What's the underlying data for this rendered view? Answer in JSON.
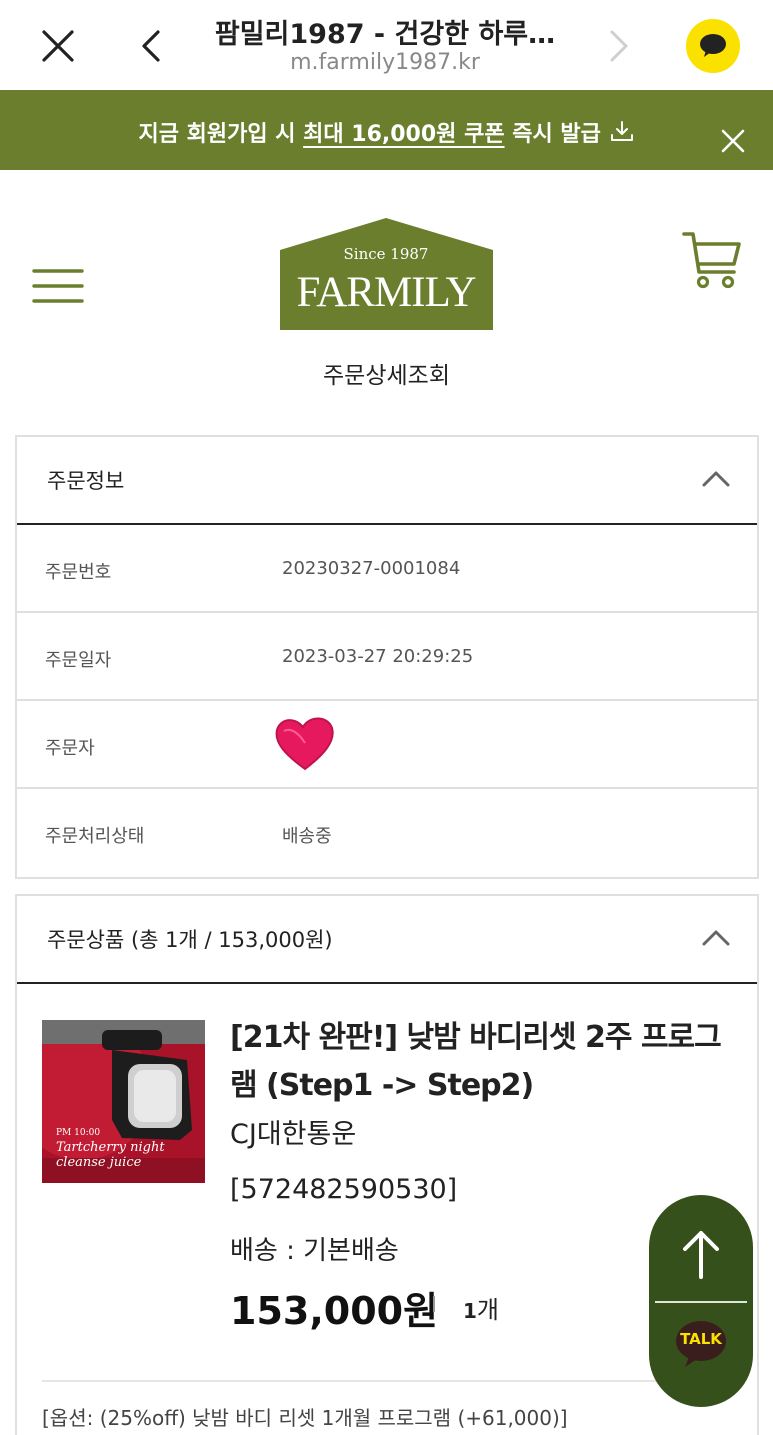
{
  "browser": {
    "title": "팜밀리1987 - 건강한 하루…",
    "url": "m.farmily1987.kr",
    "close_icon": "close-icon",
    "back_icon": "chevron-left-icon",
    "forward_icon": "chevron-right-icon",
    "share_icon": "kakao-chat-icon"
  },
  "promo": {
    "prefix": "지금 회원가입 시 ",
    "highlight": "최대 16,000원 쿠폰",
    "suffix": " 즉시 발급",
    "download_icon": "download-icon",
    "close_icon": "close-icon"
  },
  "header": {
    "logo_since": "Since 1987",
    "logo_name": "FARMILY",
    "page_title": "주문상세조회",
    "menu_icon": "hamburger-icon",
    "cart_icon": "cart-icon"
  },
  "order_info": {
    "heading": "주문정보",
    "rows": [
      {
        "label": "주문번호",
        "value": "20230327-0001084"
      },
      {
        "label": "주문일자",
        "value": "2023-03-27 20:29:25"
      },
      {
        "label": "주문자",
        "value": ""
      },
      {
        "label": "주문처리상태",
        "value": "배송중"
      }
    ]
  },
  "order_products": {
    "heading": "주문상품 (총 1개 / 153,000원)",
    "item": {
      "name": "[21차 완판!] 낮밤 바디리셋 2주 프로그램 (Step1 -> Step2)",
      "carrier": "CJ대한통운",
      "tracking": "[572482590530]",
      "shipping": "배송 : 기본배송",
      "price": "153,000원",
      "qty_num": "1",
      "qty_unit": "개",
      "option": "[옵션: (25%off) 낮밤 바디 리셋 1개월 프로그램 (+61,000)]",
      "thumb_caption_small": "PM 10:00",
      "thumb_caption_1": "Tartcherry night",
      "thumb_caption_2": "cleanse juice"
    }
  },
  "floating": {
    "up_icon": "arrow-up-icon",
    "talk_label": "TALK"
  },
  "colors": {
    "brand_green": "#6b7e2d",
    "floating_green": "#35501b",
    "kakao_yellow": "#fae100"
  }
}
